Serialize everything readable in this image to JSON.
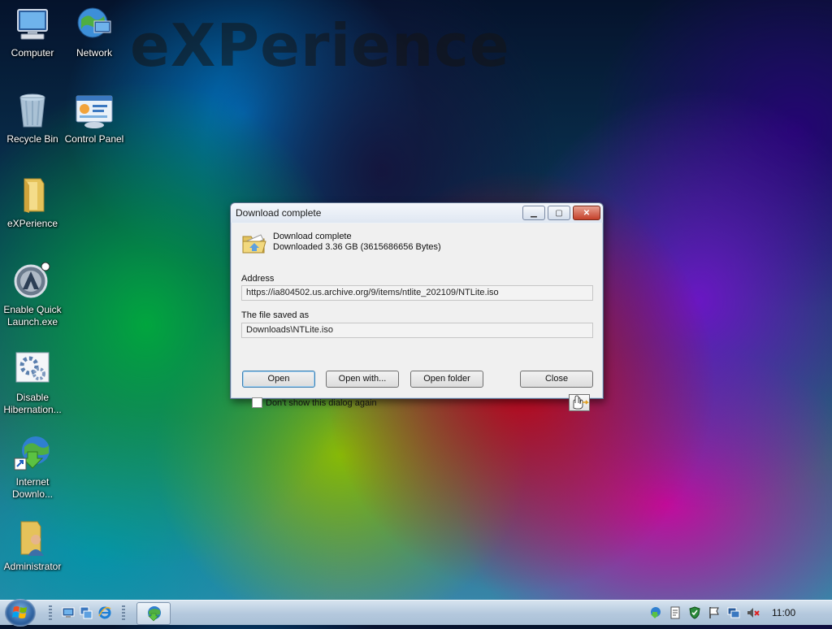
{
  "desktop": {
    "watermark": "eXPerience",
    "icons": [
      {
        "label": "Computer",
        "icon": "computer-icon"
      },
      {
        "label": "Network",
        "icon": "network-icon"
      },
      {
        "label": "Recycle Bin",
        "icon": "recycle-bin-icon"
      },
      {
        "label": "Control Panel",
        "icon": "control-panel-icon"
      },
      {
        "label": "eXPerience",
        "icon": "folder-icon"
      },
      {
        "label": "Enable Quick Launch.exe",
        "icon": "quick-launch-exe-icon"
      },
      {
        "label": "Disable Hibernation...",
        "icon": "gear-settings-icon"
      },
      {
        "label": "Internet Downlo...",
        "icon": "internet-download-manager-icon"
      },
      {
        "label": "Administrator",
        "icon": "user-folder-icon"
      }
    ]
  },
  "dialog": {
    "title": "Download complete",
    "heading": "Download complete",
    "summary": "Downloaded 3.36  GB (3615686656 Bytes)",
    "address_label": "Address",
    "address_value": "https://ia804502.us.archive.org/9/items/ntlite_202109/NTLite.iso",
    "saved_label": "The file saved as",
    "saved_value": "Downloads\\NTLite.iso",
    "buttons": {
      "open": "Open",
      "open_with": "Open with...",
      "open_folder": "Open folder",
      "close": "Close"
    },
    "checkbox_label": "Don't show this dialog again",
    "checkbox_checked": false
  },
  "taskbar": {
    "clock": "11:00",
    "quick_launch": [
      "show-desktop-icon",
      "switch-windows-icon",
      "internet-explorer-icon"
    ],
    "tray_icons": [
      "idm-tray-icon",
      "notepad-tray-icon",
      "security-shield-icon",
      "action-center-flag-icon",
      "network-tray-icon",
      "volume-muted-icon"
    ]
  },
  "colors": {
    "dialog_bg": "#f0f0f0",
    "default_button_border": "#3c7fb1",
    "close_button": "#c4402a"
  }
}
